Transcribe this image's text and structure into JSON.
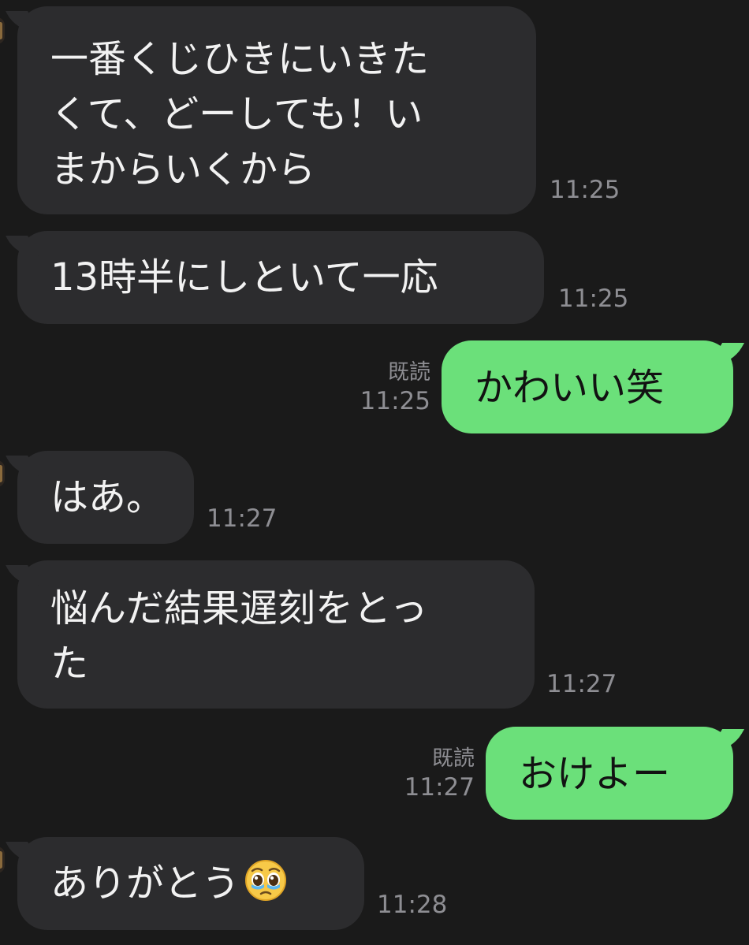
{
  "messages": [
    {
      "direction": "incoming",
      "lines": [
        "一番くじひきにいきた",
        "くて、どーしても！い",
        "まからいくから"
      ],
      "time": "11:25"
    },
    {
      "direction": "incoming",
      "lines": [
        "13時半にしといて一応"
      ],
      "time": "11:25"
    },
    {
      "direction": "outgoing",
      "lines": [
        "かわいい笑"
      ],
      "read_label": "既読",
      "time": "11:25"
    },
    {
      "direction": "incoming",
      "lines": [
        "はあ。"
      ],
      "time": "11:27"
    },
    {
      "direction": "incoming",
      "lines": [
        "悩んだ結果遅刻をとっ",
        "た"
      ],
      "time": "11:27"
    },
    {
      "direction": "outgoing",
      "lines": [
        "おけよー"
      ],
      "read_label": "既読",
      "time": "11:27"
    },
    {
      "direction": "incoming",
      "lines": [
        "ありがとう"
      ],
      "emoji": "pleading-face-with-tears-emoji",
      "time": "11:28"
    }
  ],
  "colors": {
    "background": "#1a1a1a",
    "incoming_bubble": "#2c2c2e",
    "outgoing_bubble": "#6be07a",
    "meta_text": "#8e8e93"
  }
}
